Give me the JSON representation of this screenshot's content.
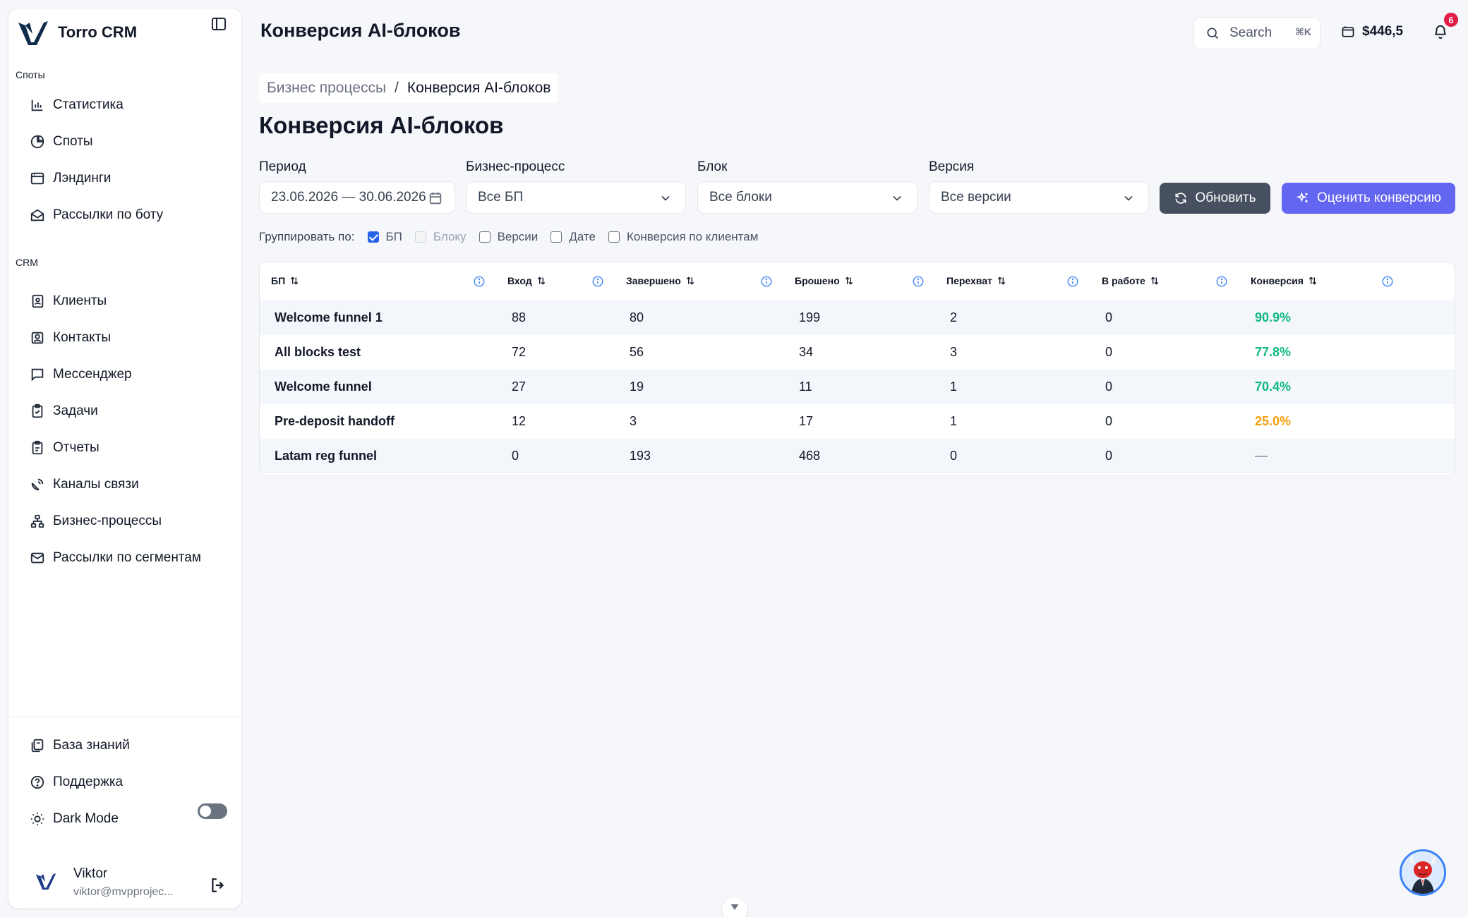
{
  "app": {
    "name": "Torro CRM"
  },
  "sidebar": {
    "section_spots": "Споты",
    "spots_items": [
      {
        "label": "Статистика",
        "icon": "bar-chart-icon"
      },
      {
        "label": "Споты",
        "icon": "pie-chart-icon"
      },
      {
        "label": "Лэндинги",
        "icon": "browser-window-icon"
      },
      {
        "label": "Рассылки по боту",
        "icon": "mail-open-icon"
      }
    ],
    "section_crm": "CRM",
    "crm_items": [
      {
        "label": "Клиенты",
        "icon": "contact-book-icon"
      },
      {
        "label": "Контакты",
        "icon": "contact-card-icon"
      },
      {
        "label": "Мессенджер",
        "icon": "chat-bubble-icon"
      },
      {
        "label": "Задачи",
        "icon": "clipboard-icon"
      },
      {
        "label": "Отчеты",
        "icon": "report-icon"
      },
      {
        "label": "Каналы связи",
        "icon": "satellite-dish-icon"
      },
      {
        "label": "Бизнес-процессы",
        "icon": "workflow-icon"
      },
      {
        "label": "Рассылки по сегментам",
        "icon": "mail-icon"
      }
    ],
    "bottom_items": [
      {
        "label": "База знаний",
        "icon": "library-icon"
      },
      {
        "label": "Поддержка",
        "icon": "help-circle-icon"
      }
    ],
    "dark_mode_label": "Dark Mode",
    "dark_mode_on": false,
    "user": {
      "name": "Viktor",
      "email": "viktor@mvpprojec..."
    }
  },
  "header": {
    "title": "Конверсия AI-блоков",
    "search_placeholder": "Search",
    "search_shortcut": "⌘K",
    "balance": "$446,5",
    "notifications_count": "6"
  },
  "breadcrumb": {
    "parent": "Бизнес процессы",
    "separator": "/",
    "current": "Конверсия AI-блоков"
  },
  "page_title": "Конверсия AI-блоков",
  "filters": {
    "period": {
      "label": "Период",
      "value": "23.06.2026 — 30.06.2026"
    },
    "business_process": {
      "label": "Бизнес-процесс",
      "value": "Все БП"
    },
    "block": {
      "label": "Блок",
      "value": "Все блоки"
    },
    "version": {
      "label": "Версия",
      "value": "Все версии"
    },
    "refresh_label": "Обновить",
    "evaluate_label": "Оценить конверсию"
  },
  "group_by": {
    "label": "Группировать по:",
    "options": [
      {
        "label": "БП",
        "checked": true,
        "disabled": false
      },
      {
        "label": "Блоку",
        "checked": false,
        "disabled": true
      },
      {
        "label": "Версии",
        "checked": false,
        "disabled": false
      },
      {
        "label": "Дате",
        "checked": false,
        "disabled": false
      },
      {
        "label": "Конверсия по клиентам",
        "checked": false,
        "disabled": false
      }
    ]
  },
  "table": {
    "columns": [
      "БП",
      "Вход",
      "Завершено",
      "Брошено",
      "Перехват",
      "В работе",
      "Конверсия"
    ],
    "rows": [
      {
        "name": "Welcome funnel 1",
        "entry": "88",
        "completed": "80",
        "dropped": "199",
        "intercept": "2",
        "in_progress": "0",
        "conversion": "90.9%",
        "status": "high"
      },
      {
        "name": "All blocks test",
        "entry": "72",
        "completed": "56",
        "dropped": "34",
        "intercept": "3",
        "in_progress": "0",
        "conversion": "77.8%",
        "status": "high"
      },
      {
        "name": "Welcome funnel",
        "entry": "27",
        "completed": "19",
        "dropped": "11",
        "intercept": "1",
        "in_progress": "0",
        "conversion": "70.4%",
        "status": "high"
      },
      {
        "name": "Pre-deposit handoff",
        "entry": "12",
        "completed": "3",
        "dropped": "17",
        "intercept": "1",
        "in_progress": "0",
        "conversion": "25.0%",
        "status": "low"
      },
      {
        "name": "Latam reg funnel",
        "entry": "0",
        "completed": "193",
        "dropped": "468",
        "intercept": "0",
        "in_progress": "0",
        "conversion": "—",
        "status": "none"
      }
    ]
  },
  "colors": {
    "accent": "#6366f1",
    "refresh_button": "#475060",
    "conversion_high": "#10b981",
    "conversion_low": "#f59e0b",
    "conversion_none": "#9ca3af",
    "badge": "#e11d48"
  }
}
